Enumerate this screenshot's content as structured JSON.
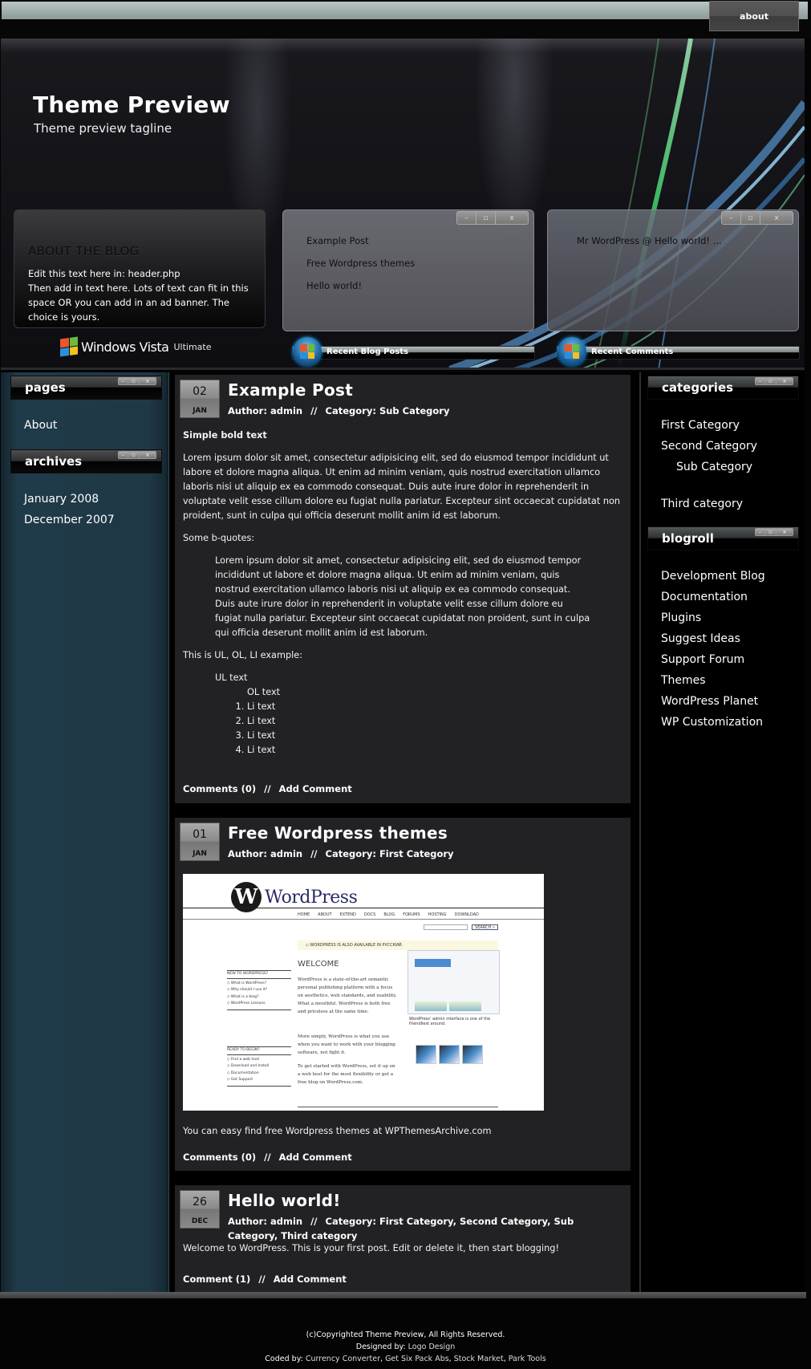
{
  "nav": {
    "items": [
      {
        "label": "about"
      }
    ]
  },
  "header": {
    "title": "Theme Preview",
    "tagline": "Theme preview tagline",
    "about_box": {
      "heading": "ABOUT THE BLOG",
      "lines": [
        "Edit this text here in: header.php",
        "Then add in text here. Lots of text can fit in this space OR you can add in an ad banner. The choice is yours."
      ]
    },
    "vista_logo": {
      "brand": "Windows Vista",
      "edition": "Ultimate",
      "icon": "windows-flag-icon"
    },
    "gadgets": [
      {
        "title": "Recent Blog Posts",
        "items": [
          "Example Post",
          "Free Wordpress themes",
          "Hello world!"
        ],
        "window_buttons": [
          "minimize",
          "maximize",
          "close"
        ]
      },
      {
        "title": "Recent Comments",
        "items": [
          "Mr WordPress @ Hello world! ..."
        ],
        "window_buttons": [
          "minimize",
          "maximize",
          "close"
        ]
      }
    ]
  },
  "left_sidebar": {
    "widgets": [
      {
        "title": "pages",
        "items": [
          "About"
        ]
      },
      {
        "title": "archives",
        "items": [
          "January 2008",
          "December 2007"
        ]
      }
    ]
  },
  "right_sidebar": {
    "widgets": [
      {
        "title": "categories",
        "items": [
          "First Category",
          "Second Category",
          "Sub Category",
          "Third category"
        ]
      },
      {
        "title": "blogroll",
        "items": [
          "Development Blog",
          "Documentation",
          "Plugins",
          "Suggest Ideas",
          "Support Forum",
          "Themes",
          "WordPress Planet",
          "WP Customization"
        ]
      }
    ]
  },
  "window_button_glyphs": {
    "minimize": "–",
    "maximize": "▫",
    "close": "x"
  },
  "posts": [
    {
      "day": "02",
      "month": "JAN",
      "title": "Example Post",
      "author_label": "Author:",
      "author": "admin",
      "category_label": "Category:",
      "categories": "Sub Category",
      "meta_sep": "//",
      "bold_text": "Simple bold text",
      "paragraph": "Lorem ipsum dolor sit amet, consectetur adipisicing elit, sed do eiusmod tempor incididunt ut labore et dolore magna aliqua. Ut enim ad minim veniam, quis nostrud exercitation ullamco laboris nisi ut aliquip ex ea commodo consequat. Duis aute irure dolor in reprehenderit in voluptate velit esse cillum dolore eu fugiat nulla pariatur. Excepteur sint occaecat cupidatat non proident, sunt in culpa qui officia deserunt mollit anim id est laborum.",
      "bquote_intro": "Some b-quotes:",
      "blockquote": "Lorem ipsum dolor sit amet, consectetur adipisicing elit, sed do eiusmod tempor incididunt ut labore et dolore magna aliqua. Ut enim ad minim veniam, quis nostrud exercitation ullamco laboris nisi ut aliquip ex ea commodo consequat. Duis aute irure dolor in reprehenderit in voluptate velit esse cillum dolore eu fugiat nulla pariatur. Excepteur sint occaecat cupidatat non proident, sunt in culpa qui officia deserunt mollit anim id est laborum.",
      "list_intro": "This is UL, OL, LI example:",
      "ul_text": "UL text",
      "ol_text": "OL text",
      "li_items": [
        "Li text",
        "Li text",
        "Li text",
        "Li text"
      ],
      "comments": "Comments (0)",
      "add_comment": "Add Comment"
    },
    {
      "day": "01",
      "month": "JAN",
      "title": "Free Wordpress themes",
      "author_label": "Author:",
      "author": "admin",
      "category_label": "Category:",
      "categories": "First Category",
      "meta_sep": "//",
      "image": {
        "alt": "WordPress.org homepage screenshot",
        "logo_text": "WordPress",
        "nav": [
          "HOME",
          "ABOUT",
          "EXTEND",
          "DOCS",
          "BLOG",
          "FORUMS",
          "HOSTING",
          "DOWNLOAD"
        ],
        "search_button": "SEARCH »",
        "notice": "◇ WORDPRESS IS ALSO AVAILABLE IN РУССКИЙ.",
        "welcome": "WELCOME",
        "para1": "WordPress is a state-of-the-art semantic personal publishing platform with a focus on aesthetics, web standards, and usability. What a mouthful. WordPress is both free and priceless at the same time.",
        "para2": "More simply, WordPress is what you use when you want to work with your blogging software, not fight it.",
        "para3": "To get started with WordPress, set it up on a web host for the most flexibility or get a free blog on WordPress.com.",
        "new_heading": "NEW TO WORDPRESS?",
        "new_links": [
          "◇ What is WordPress?",
          "◇ Why should I use it?",
          "◇ What is a blog?",
          "◇ WordPress Lessons"
        ],
        "ready_heading": "READY TO BEGIN?",
        "ready_links": [
          "◇ Find a web host",
          "◇ Download and Install",
          "◇ Documentation",
          "◇ Get Support"
        ],
        "caption": "WordPress' admin interface is one of the friendliest around."
      },
      "text": "You can easy find free Wordpress themes at WPThemesArchive.com",
      "comments": "Comments (0)",
      "add_comment": "Add Comment"
    },
    {
      "day": "26",
      "month": "DEC",
      "title": "Hello world!",
      "author_label": "Author:",
      "author": "admin",
      "category_label": "Category:",
      "categories": "First Category, Second Category, Sub Category, Third category",
      "meta_sep": "//",
      "text": "Welcome to WordPress. This is your first post. Edit or delete it, then start blogging!",
      "comments": "Comment (1)",
      "add_comment": "Add Comment"
    }
  ],
  "footer": {
    "copyright": "(c)Copyrighted Theme Preview, All Rights Reserved.",
    "designed_label": "Designed by:",
    "designed_link": "Logo Design",
    "coded_label": "Coded by:",
    "coded_links": [
      "Currency Converter",
      "Get Six Pack Abs",
      "Stock Market",
      "Park Tools"
    ]
  }
}
